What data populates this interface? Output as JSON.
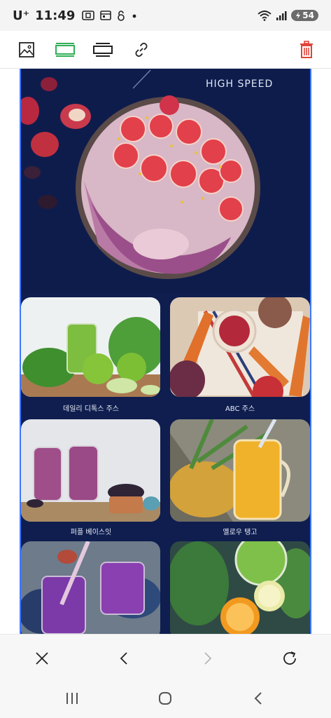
{
  "status_bar": {
    "carrier": "U⁺",
    "time": "11:49",
    "battery": "54",
    "icons": [
      "screenshot-icon",
      "calendar-icon",
      "lock-icon",
      "dot-icon",
      "wifi-icon",
      "signal-icon",
      "battery-icon"
    ]
  },
  "toolbar": {
    "icons": [
      "image-icon",
      "layout-single-icon",
      "layout-double-icon",
      "link-icon",
      "delete-icon"
    ],
    "accent_active": "#2fae55",
    "delete_color": "#e0443a"
  },
  "hero": {
    "caption": "HIGH SPEED"
  },
  "tiles": [
    {
      "label": "데일리 디톡스 주스"
    },
    {
      "label": "ABC 주스"
    },
    {
      "label": "퍼플 베이스잇"
    },
    {
      "label": "옐로우 탱고"
    },
    {
      "label": ""
    },
    {
      "label": ""
    }
  ],
  "browser_bar": {
    "icons": [
      "close-icon",
      "back-icon",
      "forward-icon",
      "refresh-icon"
    ]
  },
  "nav_bar": {
    "icons": [
      "recent-apps-icon",
      "home-icon",
      "back-nav-icon"
    ]
  },
  "colors": {
    "canvas_bg": "#0f1e4f",
    "selection_border": "#3b76ff"
  }
}
